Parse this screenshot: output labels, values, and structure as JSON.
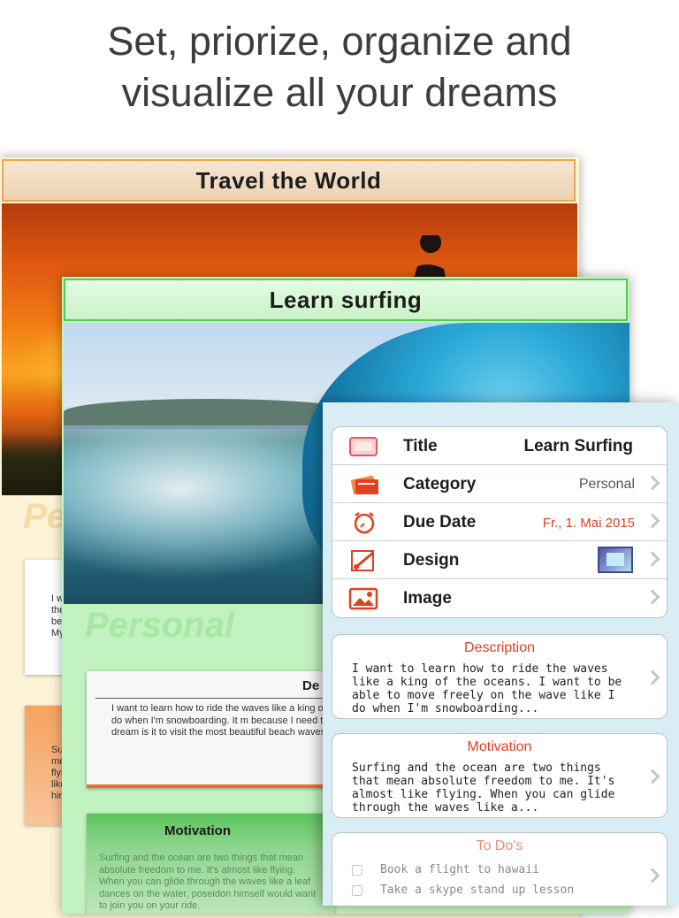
{
  "headline": {
    "line1": "Set, priorize, organize and",
    "line2": "visualize all your dreams"
  },
  "card_back": {
    "title": "Travel the World",
    "category_fragment": "Pe",
    "note1_fragments": [
      "I w",
      "the",
      "be",
      "My"
    ],
    "note2_fragments": [
      "Surfi",
      "mean",
      "flying",
      "like a",
      "himse"
    ]
  },
  "card_middle": {
    "title": "Learn surfing",
    "category": "Personal",
    "description_header": "De",
    "description_text": "I want to learn how to ride the waves like a king of the wave like I do when I'm snowboarding. It m because I need to be agile. My dream is it to visit the most beautiful beach waves.",
    "motivation_header": "Motivation",
    "motivation_text": "Surfing and the ocean are two things that mean absolute freedom to me. It's almost like flying. When you can glide through the waves like a leaf dances on the water, poseidon himself would want to join you on your ride."
  },
  "panel": {
    "rows": [
      {
        "label": "Title",
        "value": "Learn Surfing",
        "icon": "card-icon"
      },
      {
        "label": "Category",
        "value": "Personal",
        "icon": "category-cards-icon"
      },
      {
        "label": "Due Date",
        "value": "Fr., 1. Mai 2015",
        "icon": "alarm-clock-icon"
      },
      {
        "label": "Design",
        "value": "",
        "icon": "paintbrush-icon"
      },
      {
        "label": "Image",
        "value": "",
        "icon": "image-icon"
      }
    ],
    "description": {
      "title": "Description",
      "text": "I want to learn how to ride the waves like a king of the oceans. I want to be able to move freely on the wave like I do when I'm snowboarding..."
    },
    "motivation": {
      "title": "Motivation",
      "text": "Surfing and the ocean are two things that mean absolute freedom to me. It's almost like flying. When you can glide through the waves like a..."
    },
    "todos": {
      "title": "To Do's",
      "items": [
        "Book a flight to hawaii",
        "Take a skype stand up lesson"
      ]
    }
  },
  "colors": {
    "accent_red": "#e0401f",
    "back_card_border": "#e9a64f",
    "middle_card_border": "#57c85a",
    "panel_bg": "#d8eef4"
  }
}
